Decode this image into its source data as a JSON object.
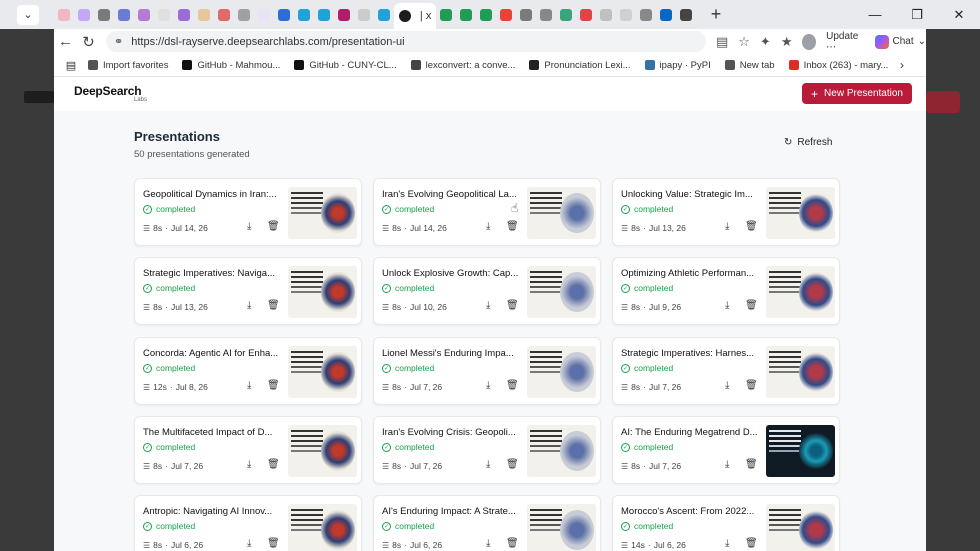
{
  "browser": {
    "url": "https://dsl-rayserve.deepsearchlabs.com/presentation-ui",
    "active_tab_label": "| x",
    "update_label": "Update",
    "chat_label": "Chat",
    "bookmarks": [
      {
        "label": "Import favorites",
        "color": "#555555"
      },
      {
        "label": "GitHub - Mahmou...",
        "color": "#111111"
      },
      {
        "label": "GitHub - CUNY-CL...",
        "color": "#111111"
      },
      {
        "label": "lexconvert: a conve...",
        "color": "#444444"
      },
      {
        "label": "Pronunciation Lexi...",
        "color": "#222222"
      },
      {
        "label": "ipapy · PyPI",
        "color": "#3572a5"
      },
      {
        "label": "New tab",
        "color": "#555555"
      },
      {
        "label": "Inbox (263) - mary...",
        "color": "#d93025"
      }
    ],
    "tab_favicons": [
      "#f4b6c2",
      "#c2a8f5",
      "#7a7a7a",
      "#6b7bd6",
      "#b57ad6",
      "#e0e0e0",
      "#9b6bd6",
      "#e7c79b",
      "#e06a6a",
      "#a0a0a0",
      "#e8e3f5",
      "#2a6ed6",
      "#1fa3d9",
      "#1fa3d9",
      "#b31b6b",
      "#cccccc",
      "#1fa3d9",
      "#1f9d55",
      "#1f9d55",
      "#1f9d55",
      "#ea4335",
      "#7a7a7a",
      "#888888",
      "#3aa57a",
      "#e04545",
      "#c0c0c0",
      "#d0d0d0",
      "#888888",
      "#0a66c2",
      "#444444"
    ]
  },
  "app": {
    "logo": "DeepSearch",
    "logo_sub": "Labs",
    "new_button": "New Presentation"
  },
  "page": {
    "title": "Presentations",
    "subtitle": "50 presentations generated",
    "refresh_label": "Refresh"
  },
  "cards": [
    {
      "title": "Geopolitical Dynamics in Iran:...",
      "status": "completed",
      "duration": "8s",
      "date": "Jul 14, 26",
      "theme": "light"
    },
    {
      "title": "Iran's Evolving Geopolitical La...",
      "status": "completed",
      "duration": "8s",
      "date": "Jul 14, 26",
      "theme": "light"
    },
    {
      "title": "Unlocking Value: Strategic Im...",
      "status": "completed",
      "duration": "8s",
      "date": "Jul 13, 26",
      "theme": "light"
    },
    {
      "title": "Strategic Imperatives: Naviga...",
      "status": "completed",
      "duration": "8s",
      "date": "Jul 13, 26",
      "theme": "light"
    },
    {
      "title": "Unlock Explosive Growth: Cap...",
      "status": "completed",
      "duration": "8s",
      "date": "Jul 10, 26",
      "theme": "light"
    },
    {
      "title": "Optimizing Athletic Performan...",
      "status": "completed",
      "duration": "8s",
      "date": "Jul 9, 26",
      "theme": "light"
    },
    {
      "title": "Concorda: Agentic AI for Enha...",
      "status": "completed",
      "duration": "12s",
      "date": "Jul 8, 26",
      "theme": "light"
    },
    {
      "title": "Lionel Messi's Enduring Impa...",
      "status": "completed",
      "duration": "8s",
      "date": "Jul 7, 26",
      "theme": "light"
    },
    {
      "title": "Strategic Imperatives: Harnes...",
      "status": "completed",
      "duration": "8s",
      "date": "Jul 7, 26",
      "theme": "light"
    },
    {
      "title": "The Multifaceted Impact of D...",
      "status": "completed",
      "duration": "8s",
      "date": "Jul 7, 26",
      "theme": "light"
    },
    {
      "title": "Iran's Evolving Crisis: Geopoli...",
      "status": "completed",
      "duration": "8s",
      "date": "Jul 7, 26",
      "theme": "light"
    },
    {
      "title": "AI: The Enduring Megatrend D...",
      "status": "completed",
      "duration": "8s",
      "date": "Jul 7, 26",
      "theme": "dark"
    },
    {
      "title": "Antropic: Navigating AI Innov...",
      "status": "completed",
      "duration": "8s",
      "date": "Jul 6, 26",
      "theme": "light"
    },
    {
      "title": "AI's Enduring Impact: A Strate...",
      "status": "completed",
      "duration": "8s",
      "date": "Jul 6, 26",
      "theme": "light"
    },
    {
      "title": "Morocco's Ascent: From 2022...",
      "status": "completed",
      "duration": "14s",
      "date": "Jul 6, 26",
      "theme": "light"
    }
  ],
  "colors": {
    "accent": "#b91c3a",
    "status": "#16a34a"
  }
}
